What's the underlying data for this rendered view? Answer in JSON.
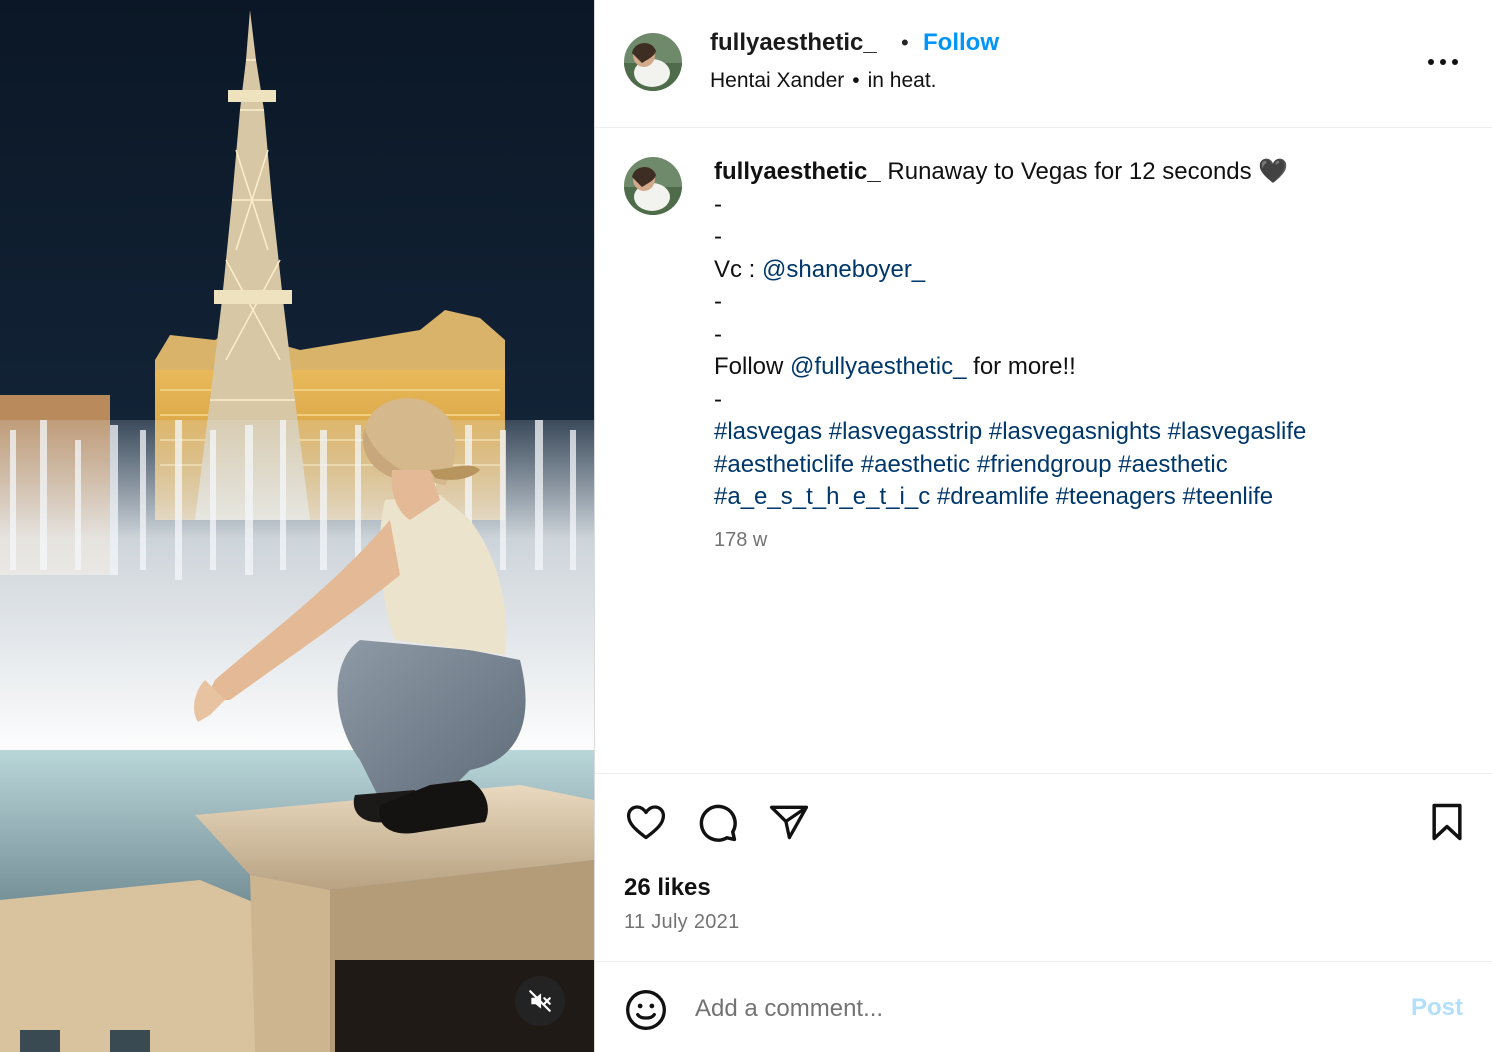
{
  "media": {
    "type": "video",
    "mute_icon": "speaker-muted-icon"
  },
  "header": {
    "username": "fullyaesthetic_",
    "separator": "•",
    "follow_label": "Follow",
    "audio_artist": "Hentai Xander",
    "audio_sep": "•",
    "audio_title": "in heat.",
    "more_icon": "more-options-icon"
  },
  "caption": {
    "username": "fullyaesthetic_",
    "text_line1": "Runaway to Vegas for 12 seconds 🖤",
    "dash1": "-",
    "dash2": "-",
    "vc_prefix": "Vc : ",
    "vc_mention": "@shaneboyer_",
    "dash3": "-",
    "dash4": "-",
    "follow_prefix": "Follow ",
    "follow_mention": "@fullyaesthetic_",
    "follow_suffix": " for more!!",
    "dash5": "-",
    "hashtags": [
      "#lasvegas",
      "#lasvegasstrip",
      "#lasvegasnights",
      "#lasvegaslife",
      "#aestheticlife",
      "#aesthetic",
      "#friendgroup",
      "#aesthetic",
      "#a_e_s_t_h_e_t_i_c",
      "#dreamlife",
      "#teenagers",
      "#teenlife"
    ],
    "time_ago": "178 w"
  },
  "actions": {
    "like_icon": "heart-icon",
    "comment_icon": "comment-bubble-icon",
    "share_icon": "send-paper-plane-icon",
    "save_icon": "bookmark-icon",
    "likes": "26 likes",
    "date": "11 July 2021"
  },
  "comment": {
    "emoji_icon": "smiley-emoji-icon",
    "placeholder": "Add a comment...",
    "post_label": "Post"
  },
  "colors": {
    "link": "#00376b",
    "follow": "#0095f6",
    "post_disabled": "#b2dffc",
    "muted_text": "#737373",
    "divider": "#efefef"
  }
}
